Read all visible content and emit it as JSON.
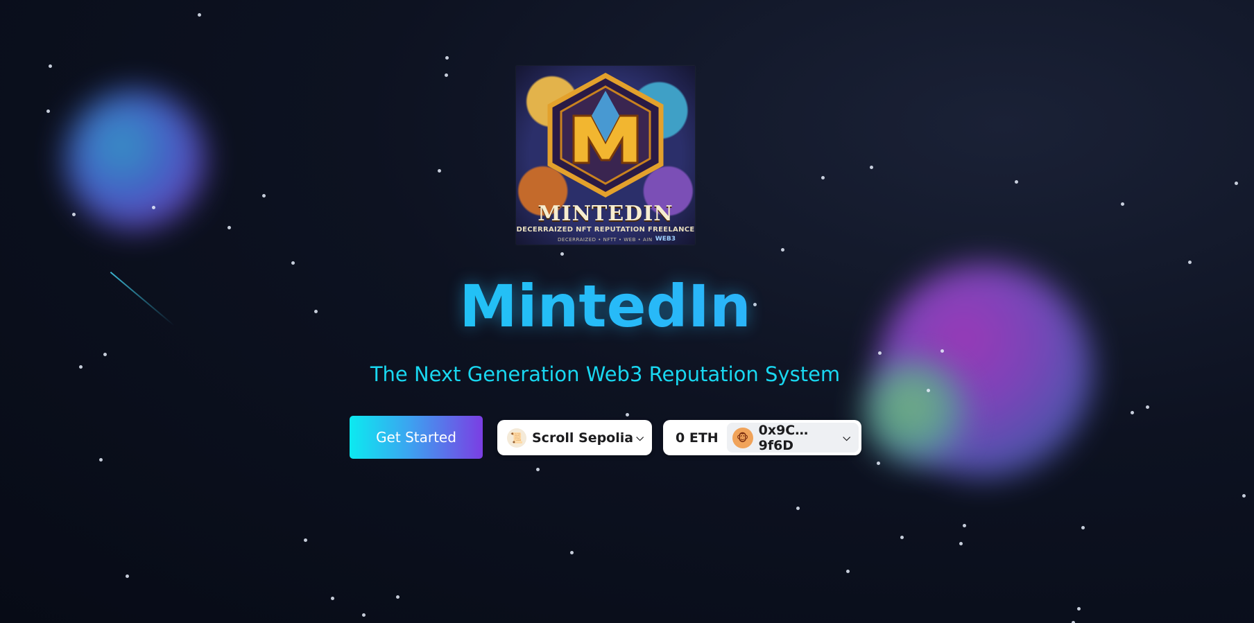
{
  "logo": {
    "wordmark": "MINTEDIN",
    "tagline": "DECERRAIZED NFT REPUTATION FREELANCE",
    "small_text": "DECERRAIZED • NFTT • WEB • AIN",
    "badge": "WEB3",
    "colors": {
      "gold": "#e3a12c",
      "blue": "#3fa0c6",
      "purple": "#7b4fb6"
    }
  },
  "hero": {
    "title": "MintedIn",
    "subtitle": "The Next Generation Web3 Reputation System"
  },
  "actions": {
    "get_started_label": "Get Started"
  },
  "wallet": {
    "chain": {
      "name": "Scroll Sepolia",
      "icon": "scroll-icon"
    },
    "balance": "0 ETH",
    "address": "0x9C…9f6D",
    "avatar_icon": "emoji-avatar-icon"
  },
  "colors": {
    "background": "#090d1a",
    "title_gradient_start": "#14d6f0",
    "title_gradient_end": "#39a0ff",
    "subtitle": "#19d7f0",
    "button_gradient": [
      "#0ceaf0",
      "#3ca3f0",
      "#7b3ee3"
    ]
  }
}
